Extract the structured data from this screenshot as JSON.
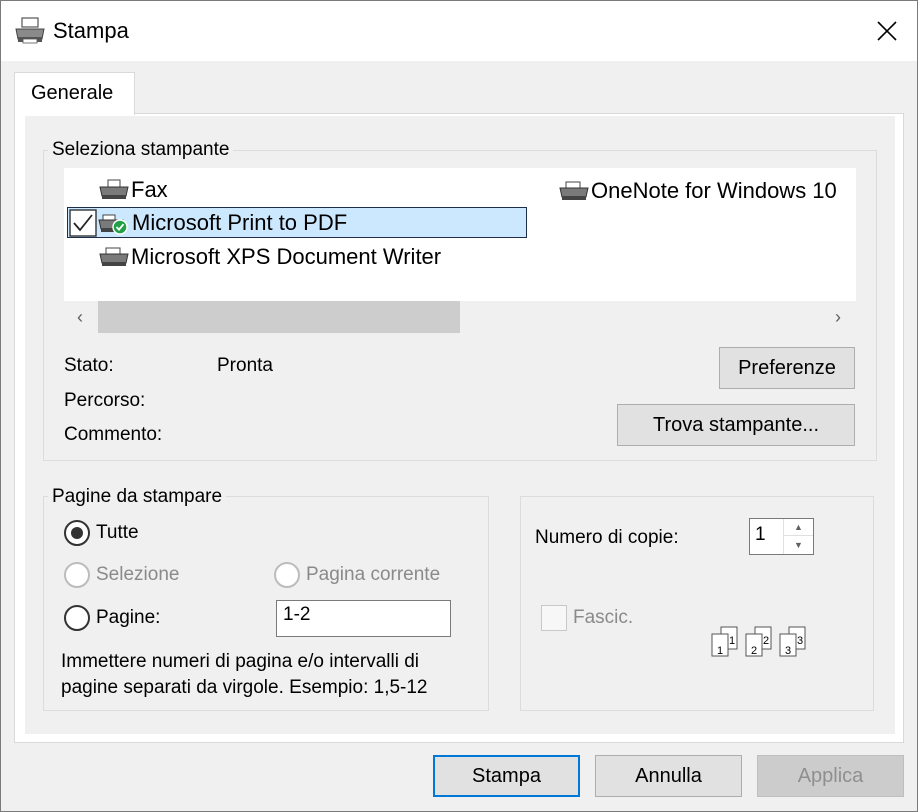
{
  "window": {
    "title": "Stampa"
  },
  "tabs": [
    {
      "label": "Generale"
    }
  ],
  "printer_group": {
    "title": "Seleziona stampante",
    "printers": [
      {
        "name": "Fax"
      },
      {
        "name": "Microsoft Print to PDF",
        "selected": true,
        "default": true
      },
      {
        "name": "Microsoft XPS Document Writer"
      },
      {
        "name": "OneNote for Windows 10"
      }
    ],
    "status_label": "Stato:",
    "status_value": "Pronta",
    "path_label": "Percorso:",
    "comment_label": "Commento:",
    "preferences_button": "Preferenze",
    "find_printer_button": "Trova stampante..."
  },
  "pages_group": {
    "title": "Pagine da stampare",
    "all_label": "Tutte",
    "selection_label": "Selezione",
    "current_page_label": "Pagina corrente",
    "pages_label": "Pagine:",
    "pages_value": "1-2",
    "hint_line1": "Immettere numeri di pagina e/o intervalli di",
    "hint_line2": "pagine separati da virgole. Esempio: 1,5-12",
    "selected": "all"
  },
  "copies_group": {
    "copies_label": "Numero di copie:",
    "copies_value": "1",
    "collate_label": "Fascic.",
    "collate_pages": [
      "1",
      "1",
      "2",
      "2",
      "3",
      "3"
    ]
  },
  "footer": {
    "print_button": "Stampa",
    "cancel_button": "Annulla",
    "apply_button": "Applica"
  },
  "colors": {
    "accent": "#0078d7",
    "selection": "#cce8ff",
    "check_green": "#22a048"
  }
}
